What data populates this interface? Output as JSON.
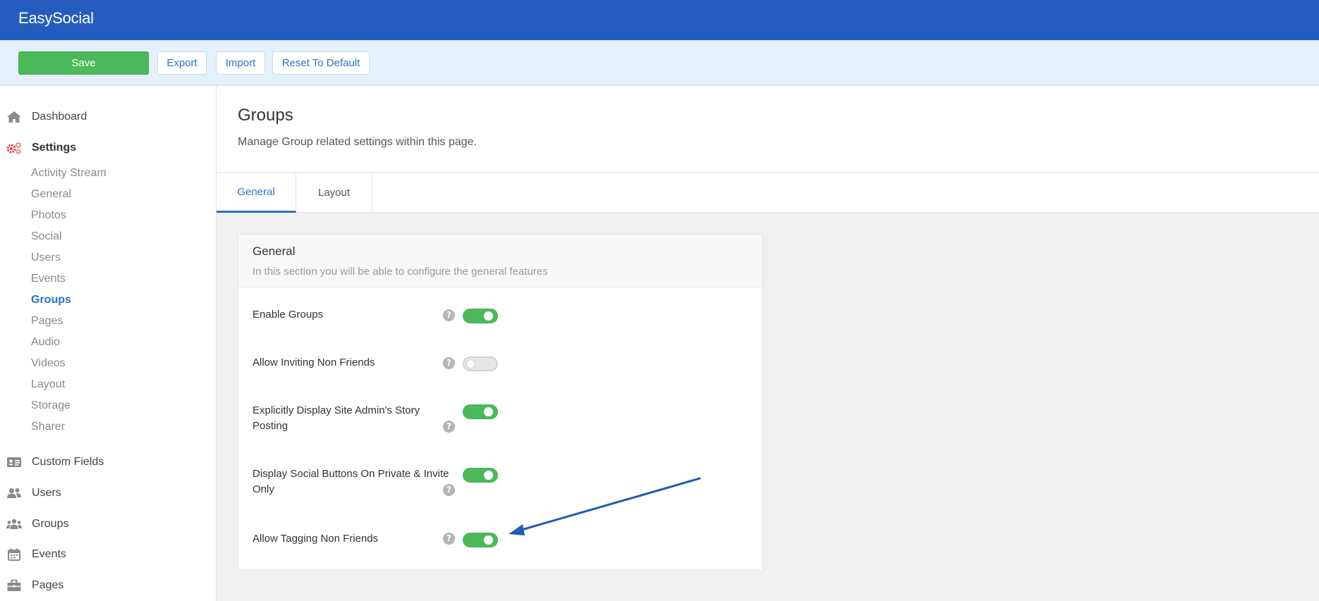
{
  "app": {
    "title": "EasySocial"
  },
  "toolbar": {
    "save_label": "Save",
    "export_label": "Export",
    "import_label": "Import",
    "reset_label": "Reset To Default"
  },
  "sidebar": {
    "top_items": [
      {
        "label": "Dashboard",
        "icon": "home-icon"
      },
      {
        "label": "Settings",
        "icon": "gears-icon",
        "active": true
      }
    ],
    "sub_items": [
      {
        "label": "Activity Stream"
      },
      {
        "label": "General"
      },
      {
        "label": "Photos"
      },
      {
        "label": "Social"
      },
      {
        "label": "Users"
      },
      {
        "label": "Events"
      },
      {
        "label": "Groups",
        "active": true
      },
      {
        "label": "Pages"
      },
      {
        "label": "Audio"
      },
      {
        "label": "Videos"
      },
      {
        "label": "Layout"
      },
      {
        "label": "Storage"
      },
      {
        "label": "Sharer"
      }
    ],
    "bottom_items": [
      {
        "label": "Custom Fields",
        "icon": "id-card-icon"
      },
      {
        "label": "Users",
        "icon": "users-icon"
      },
      {
        "label": "Groups",
        "icon": "group-icon"
      },
      {
        "label": "Events",
        "icon": "calendar-icon"
      },
      {
        "label": "Pages",
        "icon": "briefcase-icon"
      }
    ]
  },
  "page": {
    "title": "Groups",
    "description": "Manage Group related settings within this page."
  },
  "tabs": [
    {
      "label": "General",
      "active": true
    },
    {
      "label": "Layout",
      "active": false
    }
  ],
  "card": {
    "title": "General",
    "subtitle": "In this section you will be able to configure the general features",
    "settings": [
      {
        "label": "Enable Groups",
        "enabled": true
      },
      {
        "label": "Allow Inviting Non Friends",
        "enabled": false
      },
      {
        "label": "Explicitly Display Site Admin's Story Posting",
        "enabled": true
      },
      {
        "label": "Display Social Buttons On Private & Invite Only",
        "enabled": true
      },
      {
        "label": "Allow Tagging Non Friends",
        "enabled": true
      }
    ],
    "help_glyph": "?"
  },
  "colors": {
    "header": "#245dbf",
    "toolbar_bg": "#e4f0fb",
    "toggle_on": "#4cba5a",
    "link": "#2774c8",
    "annotation_arrow": "#1f5bb5"
  }
}
